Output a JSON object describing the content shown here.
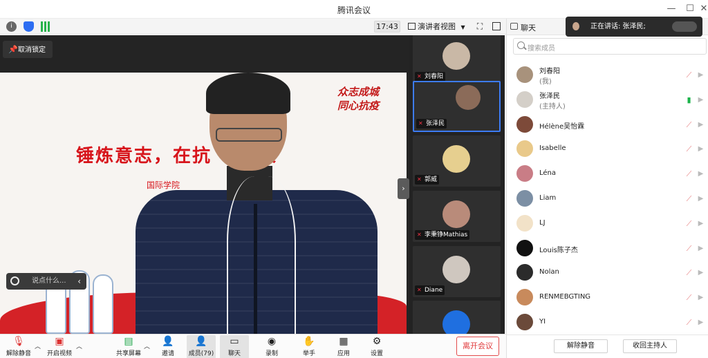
{
  "window": {
    "title": "腾讯会议"
  },
  "status": {
    "time": "17:43",
    "view_label": "演讲者视图"
  },
  "main": {
    "unpin_label": "取消锁定",
    "slide": {
      "slogan_line1": "众志成城",
      "slogan_line2": "同心抗疫",
      "headline": "锤炼意志，在抗  中成长",
      "subline": "国际学院"
    },
    "chat_placeholder": "说点什么..."
  },
  "gallery": [
    {
      "name": "刘春阳",
      "color": "#c9b8a6"
    },
    {
      "name": "张泽民",
      "color": "#8b6b59",
      "active": true
    },
    {
      "name": "郭威",
      "color": "#e6cf8f"
    },
    {
      "name": "李秉铮Mathias",
      "color": "#b98b7a"
    },
    {
      "name": "Diane",
      "color": "#cfc7bf"
    },
    {
      "name": "",
      "color": "#1f6fe0"
    }
  ],
  "toolbar": {
    "unmute": "解除静音",
    "video": "开启视频",
    "share": "共享屏幕",
    "invite": "邀请",
    "members": "成员(79)",
    "chat": "聊天",
    "record": "录制",
    "raise_hand": "举手",
    "apps": "应用",
    "settings": "设置",
    "leave": "离开会议"
  },
  "panel": {
    "tab_label": "聊天",
    "speaking": "正在讲话: 张泽民;",
    "search_placeholder": "搜索成员",
    "members": [
      {
        "name": "刘春阳",
        "sub": "(我)",
        "color": "#a8927c",
        "mic": "off"
      },
      {
        "name": "张泽民",
        "sub": "(主持人)",
        "color": "#d4cfc8",
        "mic": "on"
      },
      {
        "name": "Hélène吴怡霖",
        "sub": "",
        "color": "#7d4a39",
        "mic": "off"
      },
      {
        "name": "Isabelle",
        "sub": "",
        "color": "#e9c98a",
        "mic": "off"
      },
      {
        "name": "Léna",
        "sub": "",
        "color": "#c97d86",
        "mic": "off"
      },
      {
        "name": "Liam",
        "sub": "",
        "color": "#7c8fa4",
        "mic": "off"
      },
      {
        "name": "LJ",
        "sub": "",
        "color": "#f2e2c8",
        "mic": "off"
      },
      {
        "name": "Louis陈子杰",
        "sub": "",
        "color": "#111111",
        "mic": "off"
      },
      {
        "name": "Nolan",
        "sub": "",
        "color": "#2b2b2b",
        "mic": "off"
      },
      {
        "name": "RENMEBGTING",
        "sub": "",
        "color": "#c88a5c",
        "mic": "off"
      },
      {
        "name": "YI",
        "sub": "",
        "color": "#6b4a3a",
        "mic": "off"
      }
    ],
    "footer": {
      "unmute_all": "解除静音",
      "reclaim_host": "收回主持人"
    }
  }
}
